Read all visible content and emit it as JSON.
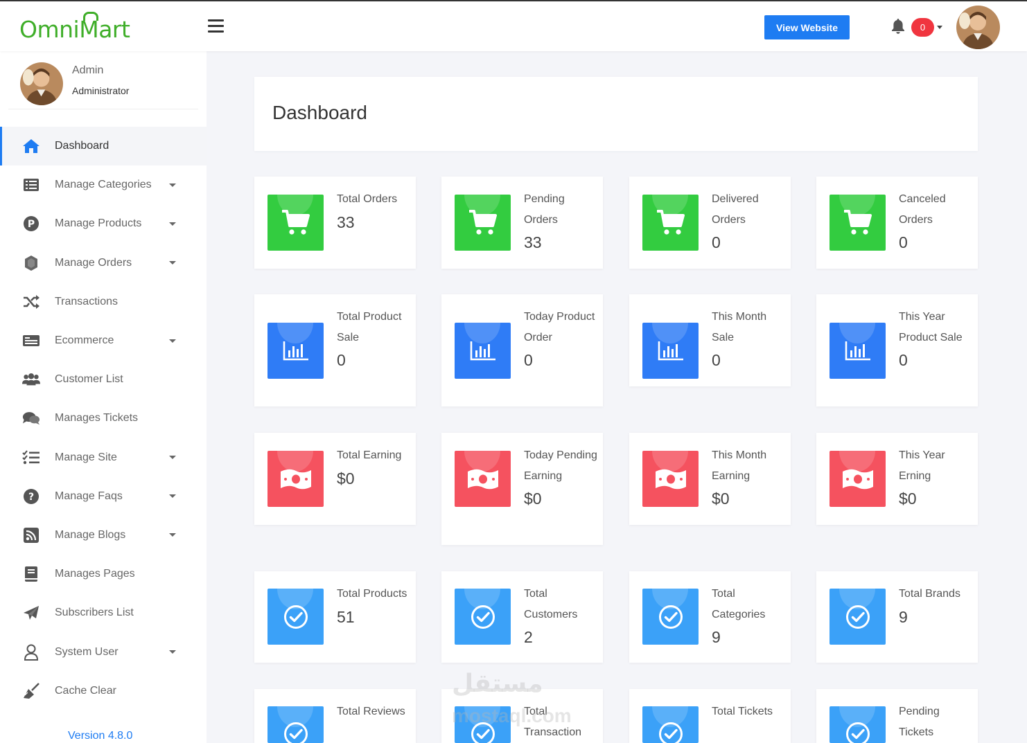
{
  "header": {
    "logo_text_left": "Omni",
    "logo_text_m": "M",
    "logo_text_right": "art",
    "view_website_label": "View Website",
    "notification_count": "0"
  },
  "profile": {
    "name": "Admin",
    "role": "Administrator"
  },
  "sidebar": {
    "items": [
      {
        "label": "Dashboard",
        "icon": "home-icon",
        "active": true,
        "has_caret": false
      },
      {
        "label": "Manage Categories",
        "icon": "list-icon",
        "has_caret": true
      },
      {
        "label": "Manage Products",
        "icon": "product-p-icon",
        "has_caret": true
      },
      {
        "label": "Manage Orders",
        "icon": "orders-icon",
        "has_caret": true
      },
      {
        "label": "Transactions",
        "icon": "shuffle-icon",
        "has_caret": false
      },
      {
        "label": "Ecommerce",
        "icon": "ecommerce-icon",
        "has_caret": true
      },
      {
        "label": "Customer List",
        "icon": "users-icon",
        "has_caret": false
      },
      {
        "label": "Manages Tickets",
        "icon": "comments-icon",
        "has_caret": false
      },
      {
        "label": "Manage Site",
        "icon": "tasks-icon",
        "has_caret": true
      },
      {
        "label": "Manage Faqs",
        "icon": "question-icon",
        "has_caret": true
      },
      {
        "label": "Manage Blogs",
        "icon": "rss-icon",
        "has_caret": true
      },
      {
        "label": "Manages Pages",
        "icon": "book-icon",
        "has_caret": false
      },
      {
        "label": "Subscribers List",
        "icon": "paper-plane-icon",
        "has_caret": false
      },
      {
        "label": "System User",
        "icon": "user-icon",
        "has_caret": true
      },
      {
        "label": "Cache Clear",
        "icon": "broom-icon",
        "has_caret": false
      }
    ],
    "version": "Version 4.8.0"
  },
  "page_title": "Dashboard",
  "stats": [
    [
      {
        "label": "Total Orders",
        "value": "33",
        "color": "#33cc40",
        "icon": "cart-icon"
      },
      {
        "label": "Pending Orders",
        "value": "33",
        "color": "#33cc40",
        "icon": "cart-icon"
      },
      {
        "label": "Delivered Orders",
        "value": "0",
        "color": "#33cc40",
        "icon": "cart-icon"
      },
      {
        "label": "Canceled Orders",
        "value": "0",
        "color": "#33cc40",
        "icon": "cart-icon"
      }
    ],
    [
      {
        "label": "Total Product Sale",
        "value": "0",
        "color": "#2f7cf6",
        "icon": "bar-chart-icon"
      },
      {
        "label": "Today Product Order",
        "value": "0",
        "color": "#2f7cf6",
        "icon": "bar-chart-icon"
      },
      {
        "label": "This Month Sale",
        "value": "0",
        "color": "#2f7cf6",
        "icon": "bar-chart-icon"
      },
      {
        "label": "This Year Product Sale",
        "value": "0",
        "color": "#2f7cf6",
        "icon": "bar-chart-icon"
      }
    ],
    [
      {
        "label": "Total Earning",
        "value": "$0",
        "color": "#f5525f",
        "icon": "money-bill-icon"
      },
      {
        "label": "Today Pending Earning",
        "value": "$0",
        "color": "#f5525f",
        "icon": "money-bill-icon"
      },
      {
        "label": "This Month Earning",
        "value": "$0",
        "color": "#f5525f",
        "icon": "money-bill-icon"
      },
      {
        "label": "This Year Erning",
        "value": "$0",
        "color": "#f5525f",
        "icon": "money-bill-icon"
      }
    ],
    [
      {
        "label": "Total Products",
        "value": "51",
        "color": "#3ba1f8",
        "icon": "check-circle-icon"
      },
      {
        "label": "Total Customers",
        "value": "2",
        "color": "#3ba1f8",
        "icon": "check-circle-icon"
      },
      {
        "label": "Total Categories",
        "value": "9",
        "color": "#3ba1f8",
        "icon": "check-circle-icon"
      },
      {
        "label": "Total Brands",
        "value": "9",
        "color": "#3ba1f8",
        "icon": "check-circle-icon"
      }
    ],
    [
      {
        "label": "Total Reviews",
        "value": "",
        "color": "#3ba1f8",
        "icon": "check-circle-icon"
      },
      {
        "label": "Total Transaction",
        "value": "",
        "color": "#3ba1f8",
        "icon": "check-circle-icon"
      },
      {
        "label": "Total Tickets",
        "value": "",
        "color": "#3ba1f8",
        "icon": "check-circle-icon"
      },
      {
        "label": "Pending Tickets",
        "value": "",
        "color": "#3ba1f8",
        "icon": "check-circle-icon"
      }
    ]
  ],
  "watermark": {
    "arabic": "مستقل",
    "latin": "mostaql.com"
  }
}
